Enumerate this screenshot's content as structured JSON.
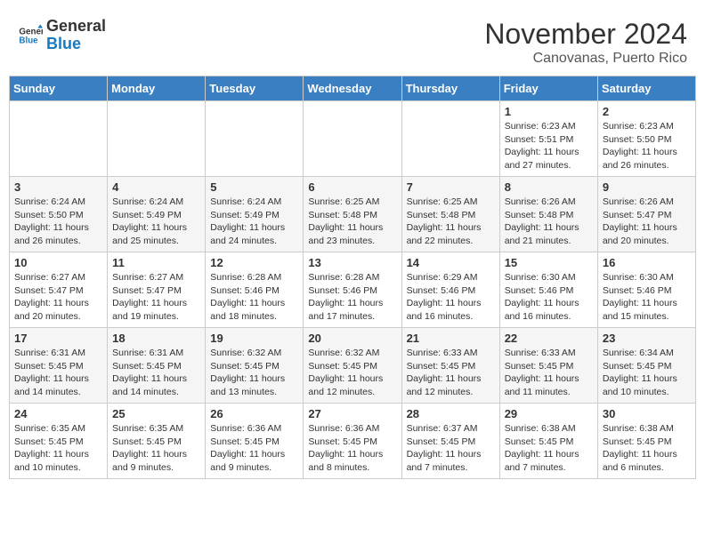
{
  "header": {
    "logo_general": "General",
    "logo_blue": "Blue",
    "month_title": "November 2024",
    "location": "Canovanas, Puerto Rico"
  },
  "weekdays": [
    "Sunday",
    "Monday",
    "Tuesday",
    "Wednesday",
    "Thursday",
    "Friday",
    "Saturday"
  ],
  "weeks": [
    [
      {
        "day": "",
        "info": ""
      },
      {
        "day": "",
        "info": ""
      },
      {
        "day": "",
        "info": ""
      },
      {
        "day": "",
        "info": ""
      },
      {
        "day": "",
        "info": ""
      },
      {
        "day": "1",
        "info": "Sunrise: 6:23 AM\nSunset: 5:51 PM\nDaylight: 11 hours and 27 minutes."
      },
      {
        "day": "2",
        "info": "Sunrise: 6:23 AM\nSunset: 5:50 PM\nDaylight: 11 hours and 26 minutes."
      }
    ],
    [
      {
        "day": "3",
        "info": "Sunrise: 6:24 AM\nSunset: 5:50 PM\nDaylight: 11 hours and 26 minutes."
      },
      {
        "day": "4",
        "info": "Sunrise: 6:24 AM\nSunset: 5:49 PM\nDaylight: 11 hours and 25 minutes."
      },
      {
        "day": "5",
        "info": "Sunrise: 6:24 AM\nSunset: 5:49 PM\nDaylight: 11 hours and 24 minutes."
      },
      {
        "day": "6",
        "info": "Sunrise: 6:25 AM\nSunset: 5:48 PM\nDaylight: 11 hours and 23 minutes."
      },
      {
        "day": "7",
        "info": "Sunrise: 6:25 AM\nSunset: 5:48 PM\nDaylight: 11 hours and 22 minutes."
      },
      {
        "day": "8",
        "info": "Sunrise: 6:26 AM\nSunset: 5:48 PM\nDaylight: 11 hours and 21 minutes."
      },
      {
        "day": "9",
        "info": "Sunrise: 6:26 AM\nSunset: 5:47 PM\nDaylight: 11 hours and 20 minutes."
      }
    ],
    [
      {
        "day": "10",
        "info": "Sunrise: 6:27 AM\nSunset: 5:47 PM\nDaylight: 11 hours and 20 minutes."
      },
      {
        "day": "11",
        "info": "Sunrise: 6:27 AM\nSunset: 5:47 PM\nDaylight: 11 hours and 19 minutes."
      },
      {
        "day": "12",
        "info": "Sunrise: 6:28 AM\nSunset: 5:46 PM\nDaylight: 11 hours and 18 minutes."
      },
      {
        "day": "13",
        "info": "Sunrise: 6:28 AM\nSunset: 5:46 PM\nDaylight: 11 hours and 17 minutes."
      },
      {
        "day": "14",
        "info": "Sunrise: 6:29 AM\nSunset: 5:46 PM\nDaylight: 11 hours and 16 minutes."
      },
      {
        "day": "15",
        "info": "Sunrise: 6:30 AM\nSunset: 5:46 PM\nDaylight: 11 hours and 16 minutes."
      },
      {
        "day": "16",
        "info": "Sunrise: 6:30 AM\nSunset: 5:46 PM\nDaylight: 11 hours and 15 minutes."
      }
    ],
    [
      {
        "day": "17",
        "info": "Sunrise: 6:31 AM\nSunset: 5:45 PM\nDaylight: 11 hours and 14 minutes."
      },
      {
        "day": "18",
        "info": "Sunrise: 6:31 AM\nSunset: 5:45 PM\nDaylight: 11 hours and 14 minutes."
      },
      {
        "day": "19",
        "info": "Sunrise: 6:32 AM\nSunset: 5:45 PM\nDaylight: 11 hours and 13 minutes."
      },
      {
        "day": "20",
        "info": "Sunrise: 6:32 AM\nSunset: 5:45 PM\nDaylight: 11 hours and 12 minutes."
      },
      {
        "day": "21",
        "info": "Sunrise: 6:33 AM\nSunset: 5:45 PM\nDaylight: 11 hours and 12 minutes."
      },
      {
        "day": "22",
        "info": "Sunrise: 6:33 AM\nSunset: 5:45 PM\nDaylight: 11 hours and 11 minutes."
      },
      {
        "day": "23",
        "info": "Sunrise: 6:34 AM\nSunset: 5:45 PM\nDaylight: 11 hours and 10 minutes."
      }
    ],
    [
      {
        "day": "24",
        "info": "Sunrise: 6:35 AM\nSunset: 5:45 PM\nDaylight: 11 hours and 10 minutes."
      },
      {
        "day": "25",
        "info": "Sunrise: 6:35 AM\nSunset: 5:45 PM\nDaylight: 11 hours and 9 minutes."
      },
      {
        "day": "26",
        "info": "Sunrise: 6:36 AM\nSunset: 5:45 PM\nDaylight: 11 hours and 9 minutes."
      },
      {
        "day": "27",
        "info": "Sunrise: 6:36 AM\nSunset: 5:45 PM\nDaylight: 11 hours and 8 minutes."
      },
      {
        "day": "28",
        "info": "Sunrise: 6:37 AM\nSunset: 5:45 PM\nDaylight: 11 hours and 7 minutes."
      },
      {
        "day": "29",
        "info": "Sunrise: 6:38 AM\nSunset: 5:45 PM\nDaylight: 11 hours and 7 minutes."
      },
      {
        "day": "30",
        "info": "Sunrise: 6:38 AM\nSunset: 5:45 PM\nDaylight: 11 hours and 6 minutes."
      }
    ]
  ]
}
